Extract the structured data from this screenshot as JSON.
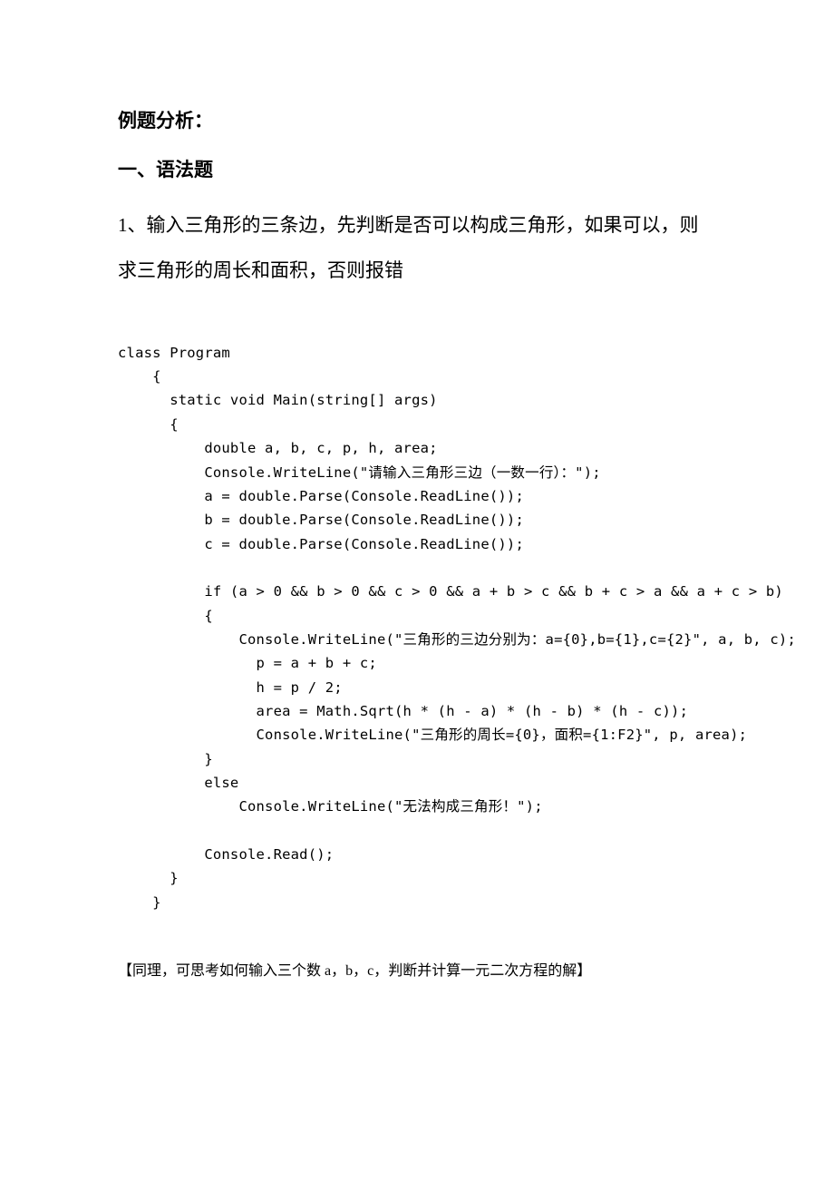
{
  "heading": "例题分析：",
  "section_title": "一、语法题",
  "problem_statement": "1、输入三角形的三条边，先判断是否可以构成三角形，如果可以，则求三角形的周长和面积，否则报错",
  "code": "class Program\n    {\n      static void Main(string[] args)\n      {\n          double a, b, c, p, h, area;\n          Console.WriteLine(\"请输入三角形三边（一数一行）：\");\n          a = double.Parse(Console.ReadLine());\n          b = double.Parse(Console.ReadLine());\n          c = double.Parse(Console.ReadLine());\n\n          if (a > 0 && b > 0 && c > 0 && a + b > c && b + c > a && a + c > b)\n          {\n              Console.WriteLine(\"三角形的三边分别为：a={0},b={1},c={2}\", a, b, c);\n                p = a + b + c;\n                h = p / 2;\n                area = Math.Sqrt(h * (h - a) * (h - b) * (h - c));\n                Console.WriteLine(\"三角形的周长={0}，面积={1:F2}\", p, area);\n          }\n          else\n              Console.WriteLine(\"无法构成三角形！\");\n\n          Console.Read();\n      }\n    }",
  "footer_note": "【同理，可思考如何输入三个数 a，b，c，判断并计算一元二次方程的解】"
}
